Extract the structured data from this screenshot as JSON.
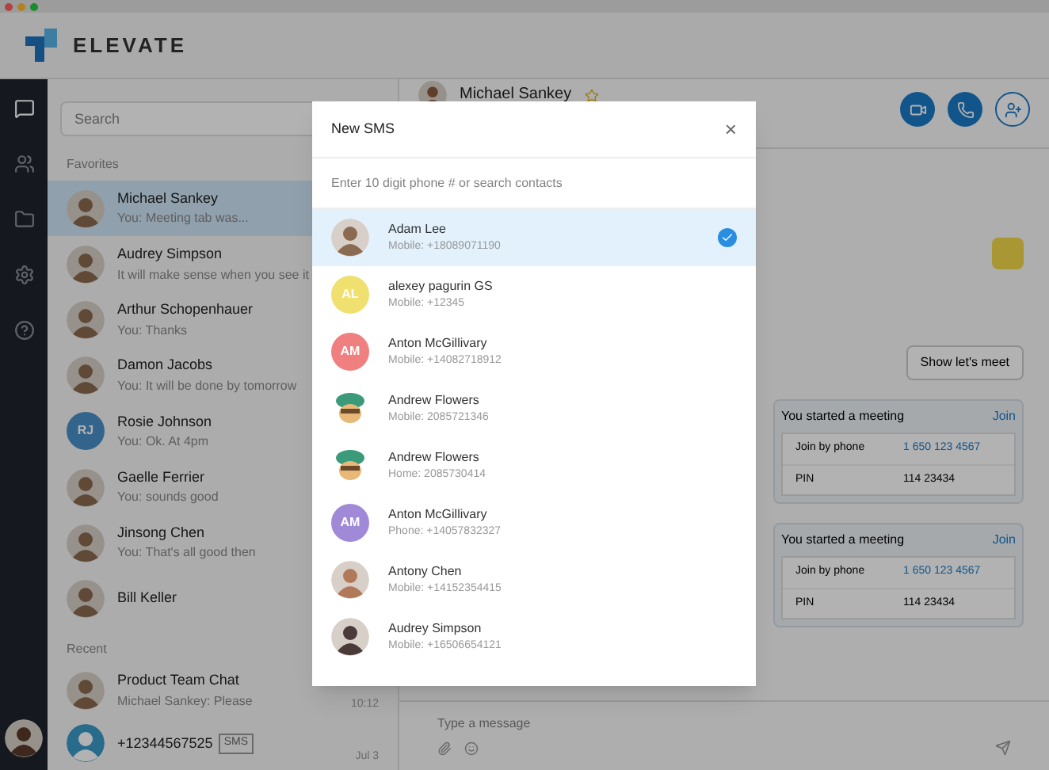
{
  "app": {
    "brand": "ELEVATE"
  },
  "search": {
    "placeholder": "Search"
  },
  "favorites_label": "Favorites",
  "contacts": [
    {
      "name": "Michael Sankey",
      "preview": "You: Meeting tab was...",
      "selected": true,
      "avatar": {
        "kind": "photo"
      }
    },
    {
      "name": "Audrey Simpson",
      "preview": "It will make sense when you see it",
      "selected": false,
      "avatar": {
        "kind": "photo"
      }
    },
    {
      "name": "Arthur Schopenhauer",
      "preview": "You: Thanks",
      "selected": false,
      "avatar": {
        "kind": "photo"
      }
    },
    {
      "name": "Damon Jacobs",
      "preview": "You: It will be done by tomorrow",
      "selected": false,
      "avatar": {
        "kind": "photo"
      }
    },
    {
      "name": "Rosie Johnson",
      "preview": "You: Ok. At 4pm",
      "selected": false,
      "avatar": {
        "kind": "initials",
        "initials": "RJ"
      }
    },
    {
      "name": "Gaelle Ferrier",
      "preview": "You: sounds good",
      "selected": false,
      "avatar": {
        "kind": "photo"
      }
    },
    {
      "name": "Jinsong Chen",
      "preview": "You: That's all good then",
      "selected": false,
      "avatar": {
        "kind": "photo"
      }
    },
    {
      "name": "Bill Keller",
      "selected": false,
      "avatar": {
        "kind": "photo"
      }
    }
  ],
  "recent_label": "Recent",
  "recent": [
    {
      "name": "Product Team Chat",
      "preview": "Michael Sankey: Please",
      "time": "10:12",
      "avatar": {
        "kind": "photo"
      }
    },
    {
      "name": "+12344567525",
      "tag": "SMS",
      "time": "Jul 3",
      "avatar": {
        "kind": "silhouette"
      }
    }
  ],
  "chat": {
    "contact": "Michael Sankey",
    "reply_button": "Show let's meet",
    "meetings": [
      {
        "title": "You started a meeting",
        "action": "Join",
        "phone_label": "Join by phone",
        "phone": "1 650 123 4567",
        "pin_label": "PIN",
        "pin": "114 23434"
      },
      {
        "title": "You started a meeting",
        "action": "Join",
        "phone_label": "Join by phone",
        "phone": "1 650 123 4567",
        "pin_label": "PIN",
        "pin": "114 23434"
      }
    ],
    "composer": {
      "placeholder": "Type a message"
    }
  },
  "modal": {
    "title": "New SMS",
    "close": "×",
    "search": {
      "placeholder": "Enter 10 digit phone # or search contacts"
    },
    "results": [
      {
        "name": "Adam Lee",
        "number": "Mobile: +18089071190",
        "selected": true,
        "avatar": {
          "kind": "photo",
          "color": "#8a6a50"
        }
      },
      {
        "name": "alexey pagurin GS",
        "number": "Mobile: +12345",
        "selected": false,
        "avatar": {
          "kind": "initials",
          "initials": "AL",
          "color": "#f0e070"
        }
      },
      {
        "name": "Anton McGillivary",
        "number": "Mobile: +14082718912",
        "selected": false,
        "avatar": {
          "kind": "initials",
          "initials": "AM",
          "color": "#f08080"
        }
      },
      {
        "name": "Andrew Flowers",
        "number": "Mobile: 2085721346",
        "selected": false,
        "avatar": {
          "kind": "cartoon",
          "color": "#3a9a7a"
        }
      },
      {
        "name": "Andrew Flowers",
        "number": "Home: 2085730414",
        "selected": false,
        "avatar": {
          "kind": "cartoon",
          "color": "#3a9a7a"
        }
      },
      {
        "name": "Anton McGillivary",
        "number": "Phone: +14057832327",
        "selected": false,
        "avatar": {
          "kind": "initials",
          "initials": "AM",
          "color": "#a08ad8"
        }
      },
      {
        "name": "Antony Chen",
        "number": "Mobile: +14152354415",
        "selected": false,
        "avatar": {
          "kind": "photo",
          "color": "#b07a5a"
        }
      },
      {
        "name": "Audrey Simpson",
        "number": "Mobile: +16506654121",
        "selected": false,
        "avatar": {
          "kind": "photo",
          "color": "#4a3a3a"
        }
      }
    ]
  }
}
